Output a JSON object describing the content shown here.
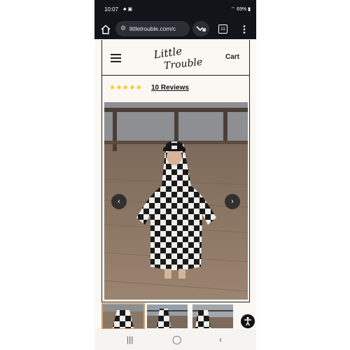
{
  "status_bar": {
    "time": "10:07",
    "battery": "69%"
  },
  "browser": {
    "url": "littletrouble.com/c",
    "tab_count": "11"
  },
  "site": {
    "logo_text": "Little Trouble",
    "cart_label": "Cart"
  },
  "reviews": {
    "stars": "★★★★★",
    "rating": 5,
    "link_text": "10 Reviews"
  },
  "gallery": {
    "prev_glyph": "‹",
    "next_glyph": "›"
  },
  "colors": {
    "star": "#f5c518",
    "frame": "#222222",
    "page_bg": "#fbf7f2",
    "chrome_bg": "#111418",
    "thumb_active": "#c9a27a"
  },
  "icons": [
    "home-icon",
    "tune-icon",
    "trend-icon",
    "tabs-icon",
    "more-vert-icon",
    "hamburger-icon",
    "accessibility-icon",
    "recents-icon",
    "home-circle-icon",
    "back-icon"
  ]
}
